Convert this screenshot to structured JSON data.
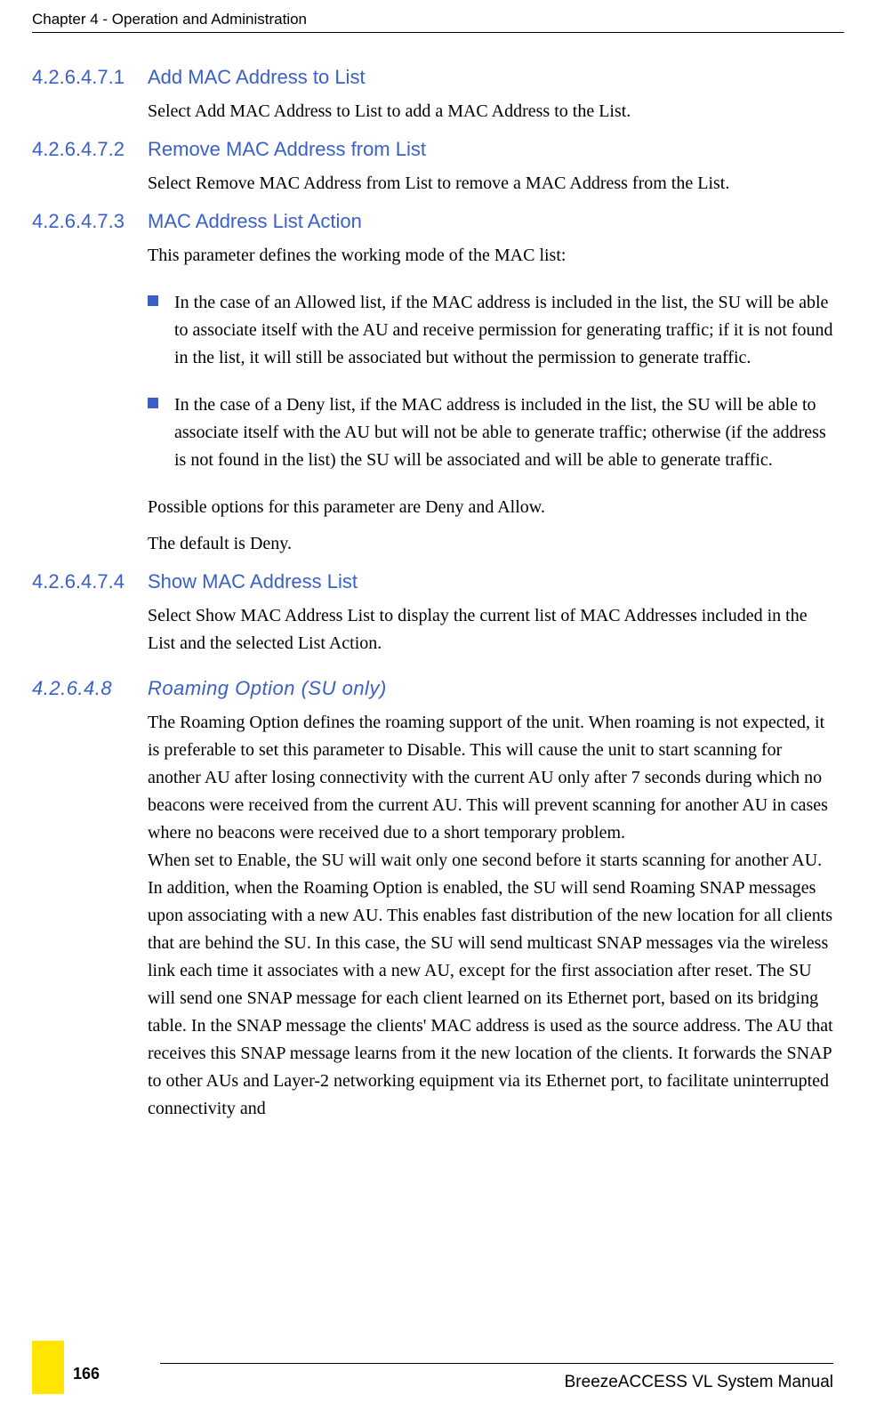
{
  "header": {
    "chapter": "Chapter 4 - Operation and Administration"
  },
  "sections": {
    "s1": {
      "num": "4.2.6.4.7.1",
      "title": "Add MAC Address to List",
      "body": "Select Add MAC Address to List to add a MAC Address to the List."
    },
    "s2": {
      "num": "4.2.6.4.7.2",
      "title": "Remove MAC Address from List",
      "body": "Select Remove MAC Address from List to remove a MAC Address from the List."
    },
    "s3": {
      "num": "4.2.6.4.7.3",
      "title": "MAC Address List Action",
      "intro": "This parameter defines the working mode of the MAC list:",
      "bullets": [
        "In the case of an Allowed list, if the MAC address is included in the list, the SU will be able to associate itself with the AU and receive permission for generating traffic; if it is not found in the list, it will still be associated but without the permission to generate traffic.",
        "In the case of a Deny list, if the MAC address is included in the list, the SU will be able to associate itself with the AU but will not be able to generate traffic; otherwise (if the address is not found in the list) the SU will be associated and will be able to generate traffic."
      ],
      "p2": "Possible options for this parameter are Deny and Allow.",
      "p3": "The default is Deny."
    },
    "s4": {
      "num": "4.2.6.4.7.4",
      "title": "Show MAC Address List",
      "body": "Select Show MAC Address List to display the current list of MAC Addresses included in the List and the selected List Action."
    },
    "s5": {
      "num": "4.2.6.4.8",
      "title": "Roaming Option (SU only)",
      "body": "The Roaming Option defines the roaming support of the unit. When roaming is not expected, it is preferable to set this parameter to Disable. This will cause the unit to start scanning for another AU after losing connectivity with the current AU only after 7 seconds during which no beacons were received from the current AU. This will prevent scanning for another AU in cases where no beacons were received due to a short temporary problem.\nWhen set to Enable, the SU will wait only one second before it starts scanning for another AU. In addition, when the Roaming Option is enabled, the SU will send Roaming SNAP messages upon associating with a new AU. This enables fast distribution of the new location for all clients that are behind the SU. In this case, the SU will send multicast SNAP messages via the wireless link each time it associates with a new AU, except for the first association after reset. The SU will send one SNAP message for each client learned on its Ethernet port, based on its bridging table. In the SNAP message the clients' MAC address is used as the source address. The AU that receives this SNAP message learns from it the new location of the clients. It forwards the SNAP to other AUs and Layer-2 networking equipment via its Ethernet port, to facilitate uninterrupted connectivity and"
    }
  },
  "footer": {
    "manual": "BreezeACCESS VL System Manual",
    "page": "166"
  }
}
